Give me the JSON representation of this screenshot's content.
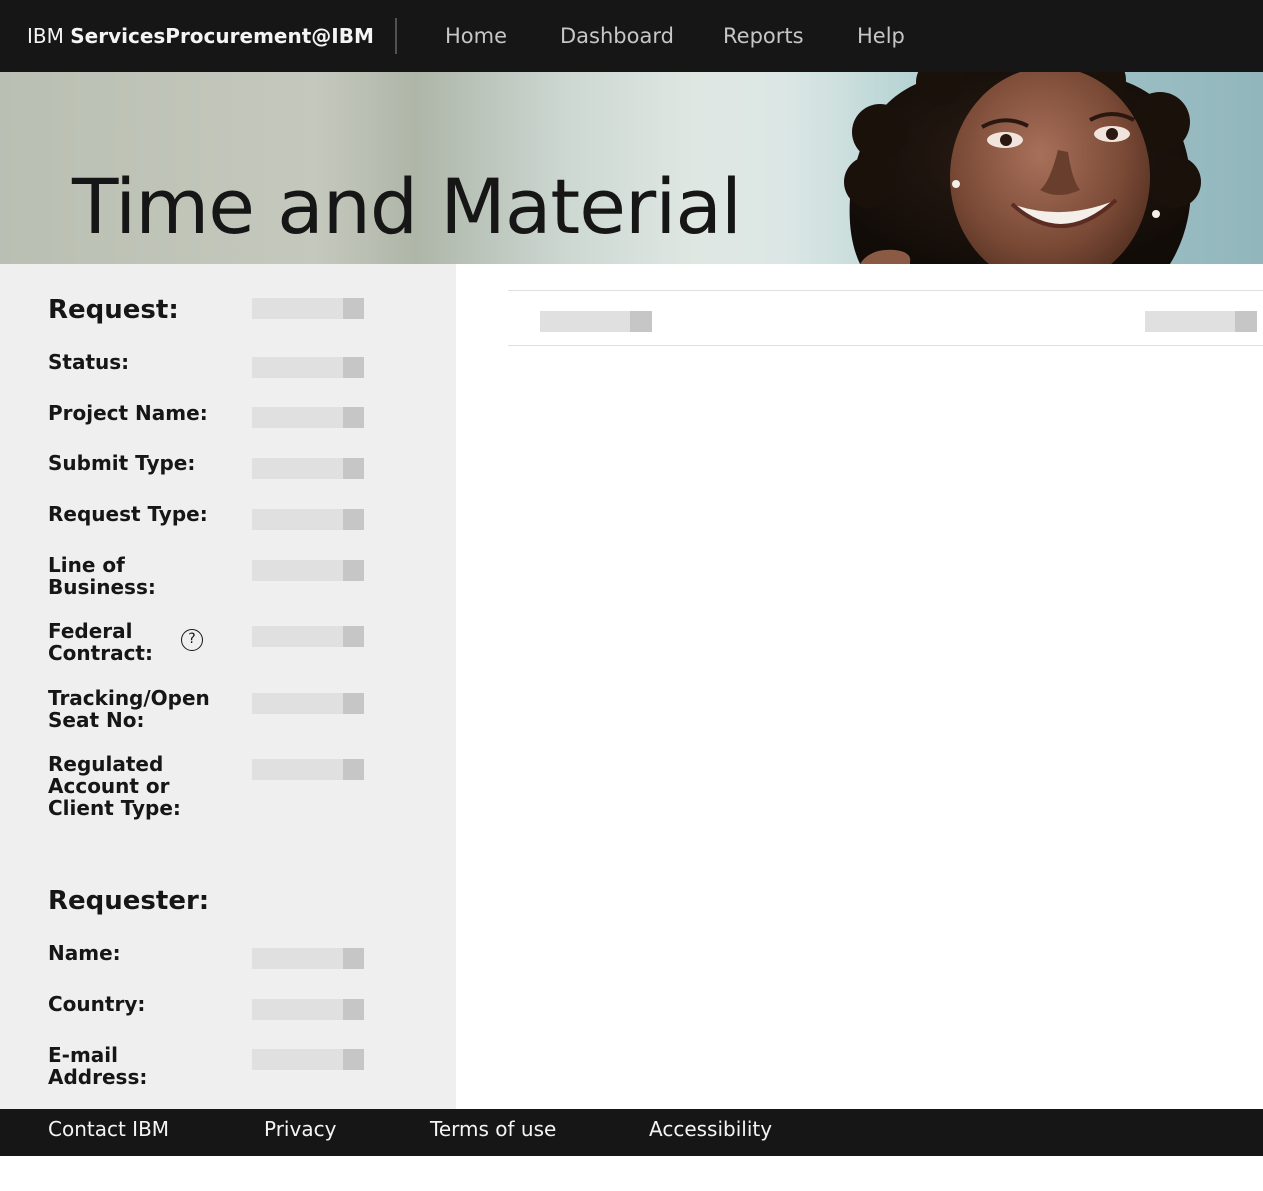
{
  "header": {
    "brand_prefix": "IBM",
    "brand_name": "ServicesProcurement@IBM",
    "nav": [
      "Home",
      "Dashboard",
      "Reports",
      "Help"
    ]
  },
  "hero": {
    "title": "Time and Material"
  },
  "request": {
    "heading": "Request:",
    "fields": [
      "Status:",
      "Project Name:",
      "Submit Type:",
      "Request Type:",
      "Line of Business:",
      "Federal Contract:",
      "Tracking/Open Seat No:",
      "Regulated Account or Client Type:"
    ],
    "help_icon_glyph": "?"
  },
  "requester": {
    "heading": "Requester:",
    "fields": [
      "Name:",
      "Country:",
      "E-mail Address:"
    ]
  },
  "footer": {
    "links": [
      "Contact IBM",
      "Privacy",
      "Terms of use",
      "Accessibility"
    ]
  },
  "colors": {
    "nav_background": "#161616",
    "panel_background": "#efefef",
    "skeleton": "#e0e0e0",
    "skeleton_dark": "#c6c6c6"
  }
}
